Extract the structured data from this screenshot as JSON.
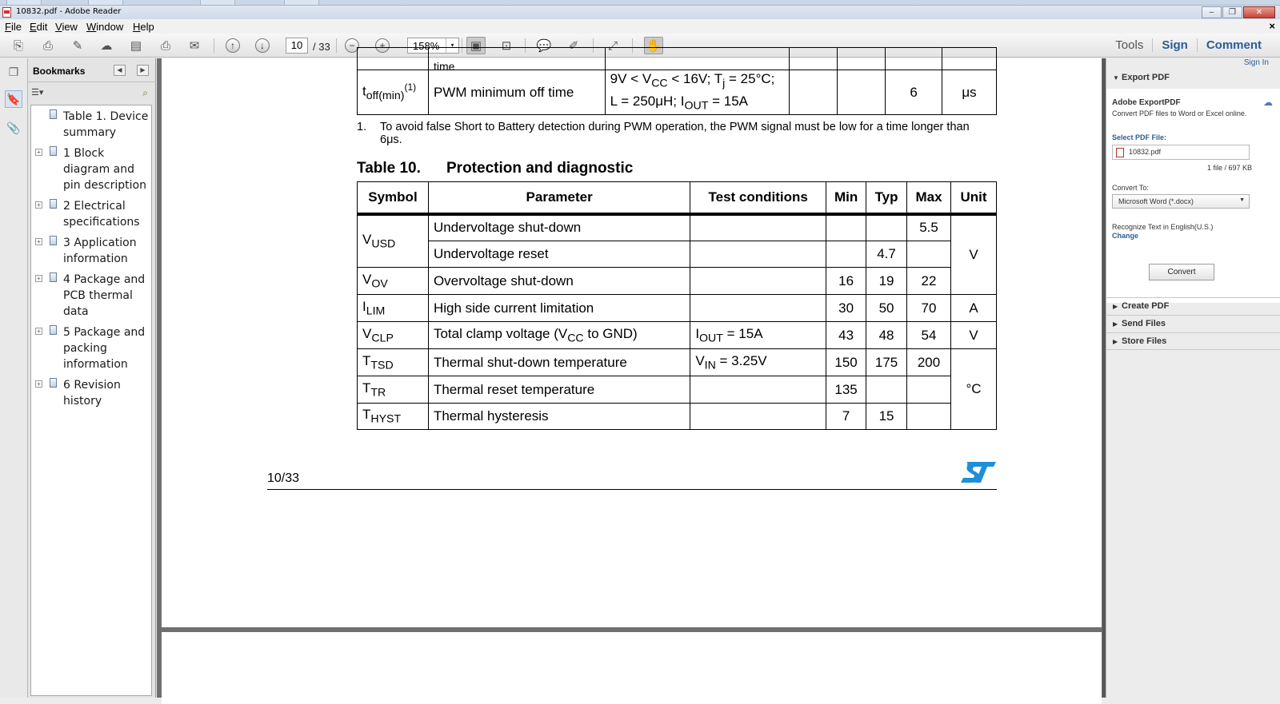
{
  "window": {
    "title": "10832.pdf - Adobe Reader",
    "controls": [
      "–",
      "❐",
      "✕"
    ],
    "doc_close": "×"
  },
  "menu": [
    "File",
    "Edit",
    "View",
    "Window",
    "Help"
  ],
  "toolbar": {
    "page_current": "10",
    "page_total": "/ 33",
    "zoom": "158%",
    "zoom_dropdown": "▾",
    "links": [
      "Tools",
      "Sign",
      "Comment"
    ]
  },
  "bookmarks": {
    "title": "Bookmarks",
    "collapse": "◀",
    "expand": "▶",
    "options": "☰▾",
    "items": [
      {
        "label": "Table 1. Device summary",
        "expandable": false
      },
      {
        "label": "1 Block diagram and pin description",
        "expandable": true
      },
      {
        "label": "2 Electrical specifications",
        "expandable": true
      },
      {
        "label": "3 Application information",
        "expandable": true
      },
      {
        "label": "4 Package and PCB thermal data",
        "expandable": true
      },
      {
        "label": "5 Package and packing information",
        "expandable": true
      },
      {
        "label": "6 Revision history",
        "expandable": true
      }
    ]
  },
  "document": {
    "prev_row_partial": "time",
    "toff_row": {
      "symbol_main": "t",
      "symbol_sub": "off(min)",
      "symbol_sup": "(1)",
      "parameter": "PWM minimum off time",
      "cond_line1_a": "9V < V",
      "cond_line1_sub": "CC",
      "cond_line1_b": " < 16V; T",
      "cond_line1_sub2": "j",
      "cond_line1_c": " = 25°C;",
      "cond_line2_a": "L = 250μH; I",
      "cond_line2_sub": "OUT",
      "cond_line2_b": " = 15A",
      "max": "6",
      "unit": "μs"
    },
    "footnote": {
      "num": "1.",
      "text": "To avoid false Short to Battery detection during PWM operation, the PWM signal must be low for a time longer than 6μs."
    },
    "table_caption": {
      "number": "Table 10.",
      "title": "Protection and diagnostic"
    },
    "table_headers": [
      "Symbol",
      "Parameter",
      "Test conditions",
      "Min",
      "Typ",
      "Max",
      "Unit"
    ],
    "rows": [
      {
        "sym": "V",
        "sym_sub": "USD",
        "param": "Undervoltage shut-down",
        "cond": "",
        "min": "",
        "typ": "",
        "max": "5.5"
      },
      {
        "param": "Undervoltage reset",
        "cond": "",
        "min": "",
        "typ": "4.7",
        "max": "",
        "unit": "V"
      },
      {
        "sym": "V",
        "sym_sub": "OV",
        "param": "Overvoltage shut-down",
        "cond": "",
        "min": "16",
        "typ": "19",
        "max": "22"
      },
      {
        "sym": "I",
        "sym_sub": "LIM",
        "param": "High side current limitation",
        "cond": "",
        "min": "30",
        "typ": "50",
        "max": "70",
        "unit": "A"
      },
      {
        "sym": "V",
        "sym_sub": "CLP",
        "param_a": "Total clamp voltage (V",
        "param_sub": "CC",
        "param_b": " to GND)",
        "cond_a": "I",
        "cond_sub": "OUT",
        "cond_b": " = 15A",
        "min": "43",
        "typ": "48",
        "max": "54",
        "unit": "V"
      },
      {
        "sym": "T",
        "sym_sub": "TSD",
        "param": "Thermal shut-down temperature",
        "cond_a": "V",
        "cond_sub": "IN",
        "cond_b": " = 3.25V",
        "min": "150",
        "typ": "175",
        "max": "200"
      },
      {
        "sym": "T",
        "sym_sub": "TR",
        "param": "Thermal reset temperature",
        "cond": "",
        "min": "135",
        "typ": "",
        "max": "",
        "unit": "°C"
      },
      {
        "sym": "T",
        "sym_sub": "HYST",
        "param": "Thermal hysteresis",
        "cond": "",
        "min": "7",
        "typ": "15",
        "max": ""
      }
    ],
    "page_number": "10/33"
  },
  "right_panel": {
    "sign_in": "Sign In",
    "export_pdf": "Export PDF",
    "adobe_exportpdf": "Adobe ExportPDF",
    "description": "Convert PDF files to Word or Excel online.",
    "select_label": "Select PDF File:",
    "file_name": "10832.pdf",
    "file_meta": "1 file / 697 KB",
    "convert_to_label": "Convert To:",
    "convert_to_value": "Microsoft Word (*.docx)",
    "recognize_text": "Recognize Text in English(U.S.)",
    "change": "Change",
    "convert_button": "Convert",
    "sections": [
      "Create PDF",
      "Send Files",
      "Store Files"
    ]
  }
}
